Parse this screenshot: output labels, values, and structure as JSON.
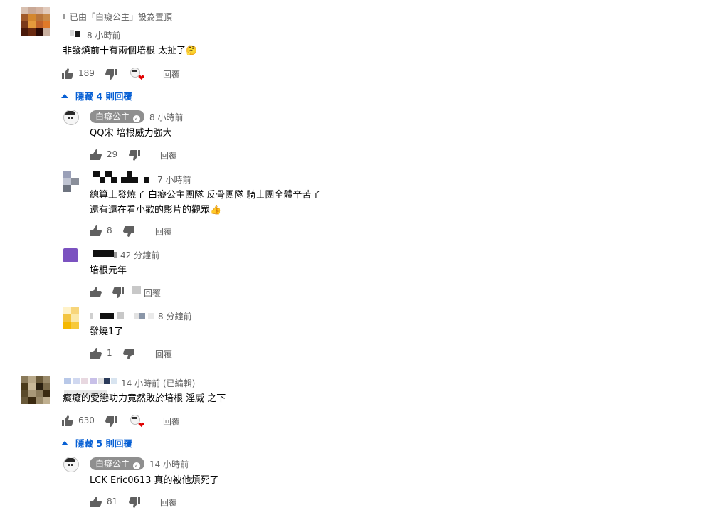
{
  "comments": [
    {
      "pinned_label": "已由「白癡公主」設為置頂",
      "time": "8 小時前",
      "text": "非發燒前十有兩個培根 太扯了🤔",
      "likes": "189",
      "reply_label": "回覆",
      "toggle_label": "隱藏 4 則回覆",
      "replies": [
        {
          "author": "白癡公主",
          "time": "8 小時前",
          "text": "QQ宋 培根威力強大",
          "likes": "29",
          "reply_label": "回覆"
        },
        {
          "author": "",
          "time": "7 小時前",
          "text_line1": "總算上發燒了  白癡公主團隊 反骨團隊 騎士團全體辛苦了",
          "text_line2": "還有還在看小歡的影片的觀眾👍",
          "likes": "8",
          "reply_label": "回覆"
        },
        {
          "author": "",
          "time": "42 分鐘前",
          "text": "培根元年",
          "likes": "",
          "reply_label": "回覆"
        },
        {
          "author": "",
          "time": "8 分鐘前",
          "text": "發燒1了",
          "likes": "1",
          "reply_label": "回覆"
        }
      ]
    },
    {
      "time": "14 小時前 (已編輯)",
      "text": "癡癡的愛戀功力竟然敗於培根 淫威 之下",
      "likes": "630",
      "reply_label": "回覆",
      "toggle_label": "隱藏 5 則回覆",
      "replies": [
        {
          "author": "白癡公主",
          "time": "14 小時前",
          "text": "LCK Eric0613 真的被他煩死了",
          "likes": "81",
          "reply_label": "回覆"
        }
      ]
    }
  ],
  "icons": {
    "like": "thumb-up-icon",
    "dislike": "thumb-down-icon",
    "creator_heart": "creator-heart-icon",
    "verified": "verified-check-icon",
    "toggle": "caret-up-icon"
  },
  "colors": {
    "link_blue": "#065fd4",
    "heart_red": "#e00000",
    "meta_gray": "#606060",
    "chip_gray": "#8f8f8f"
  }
}
